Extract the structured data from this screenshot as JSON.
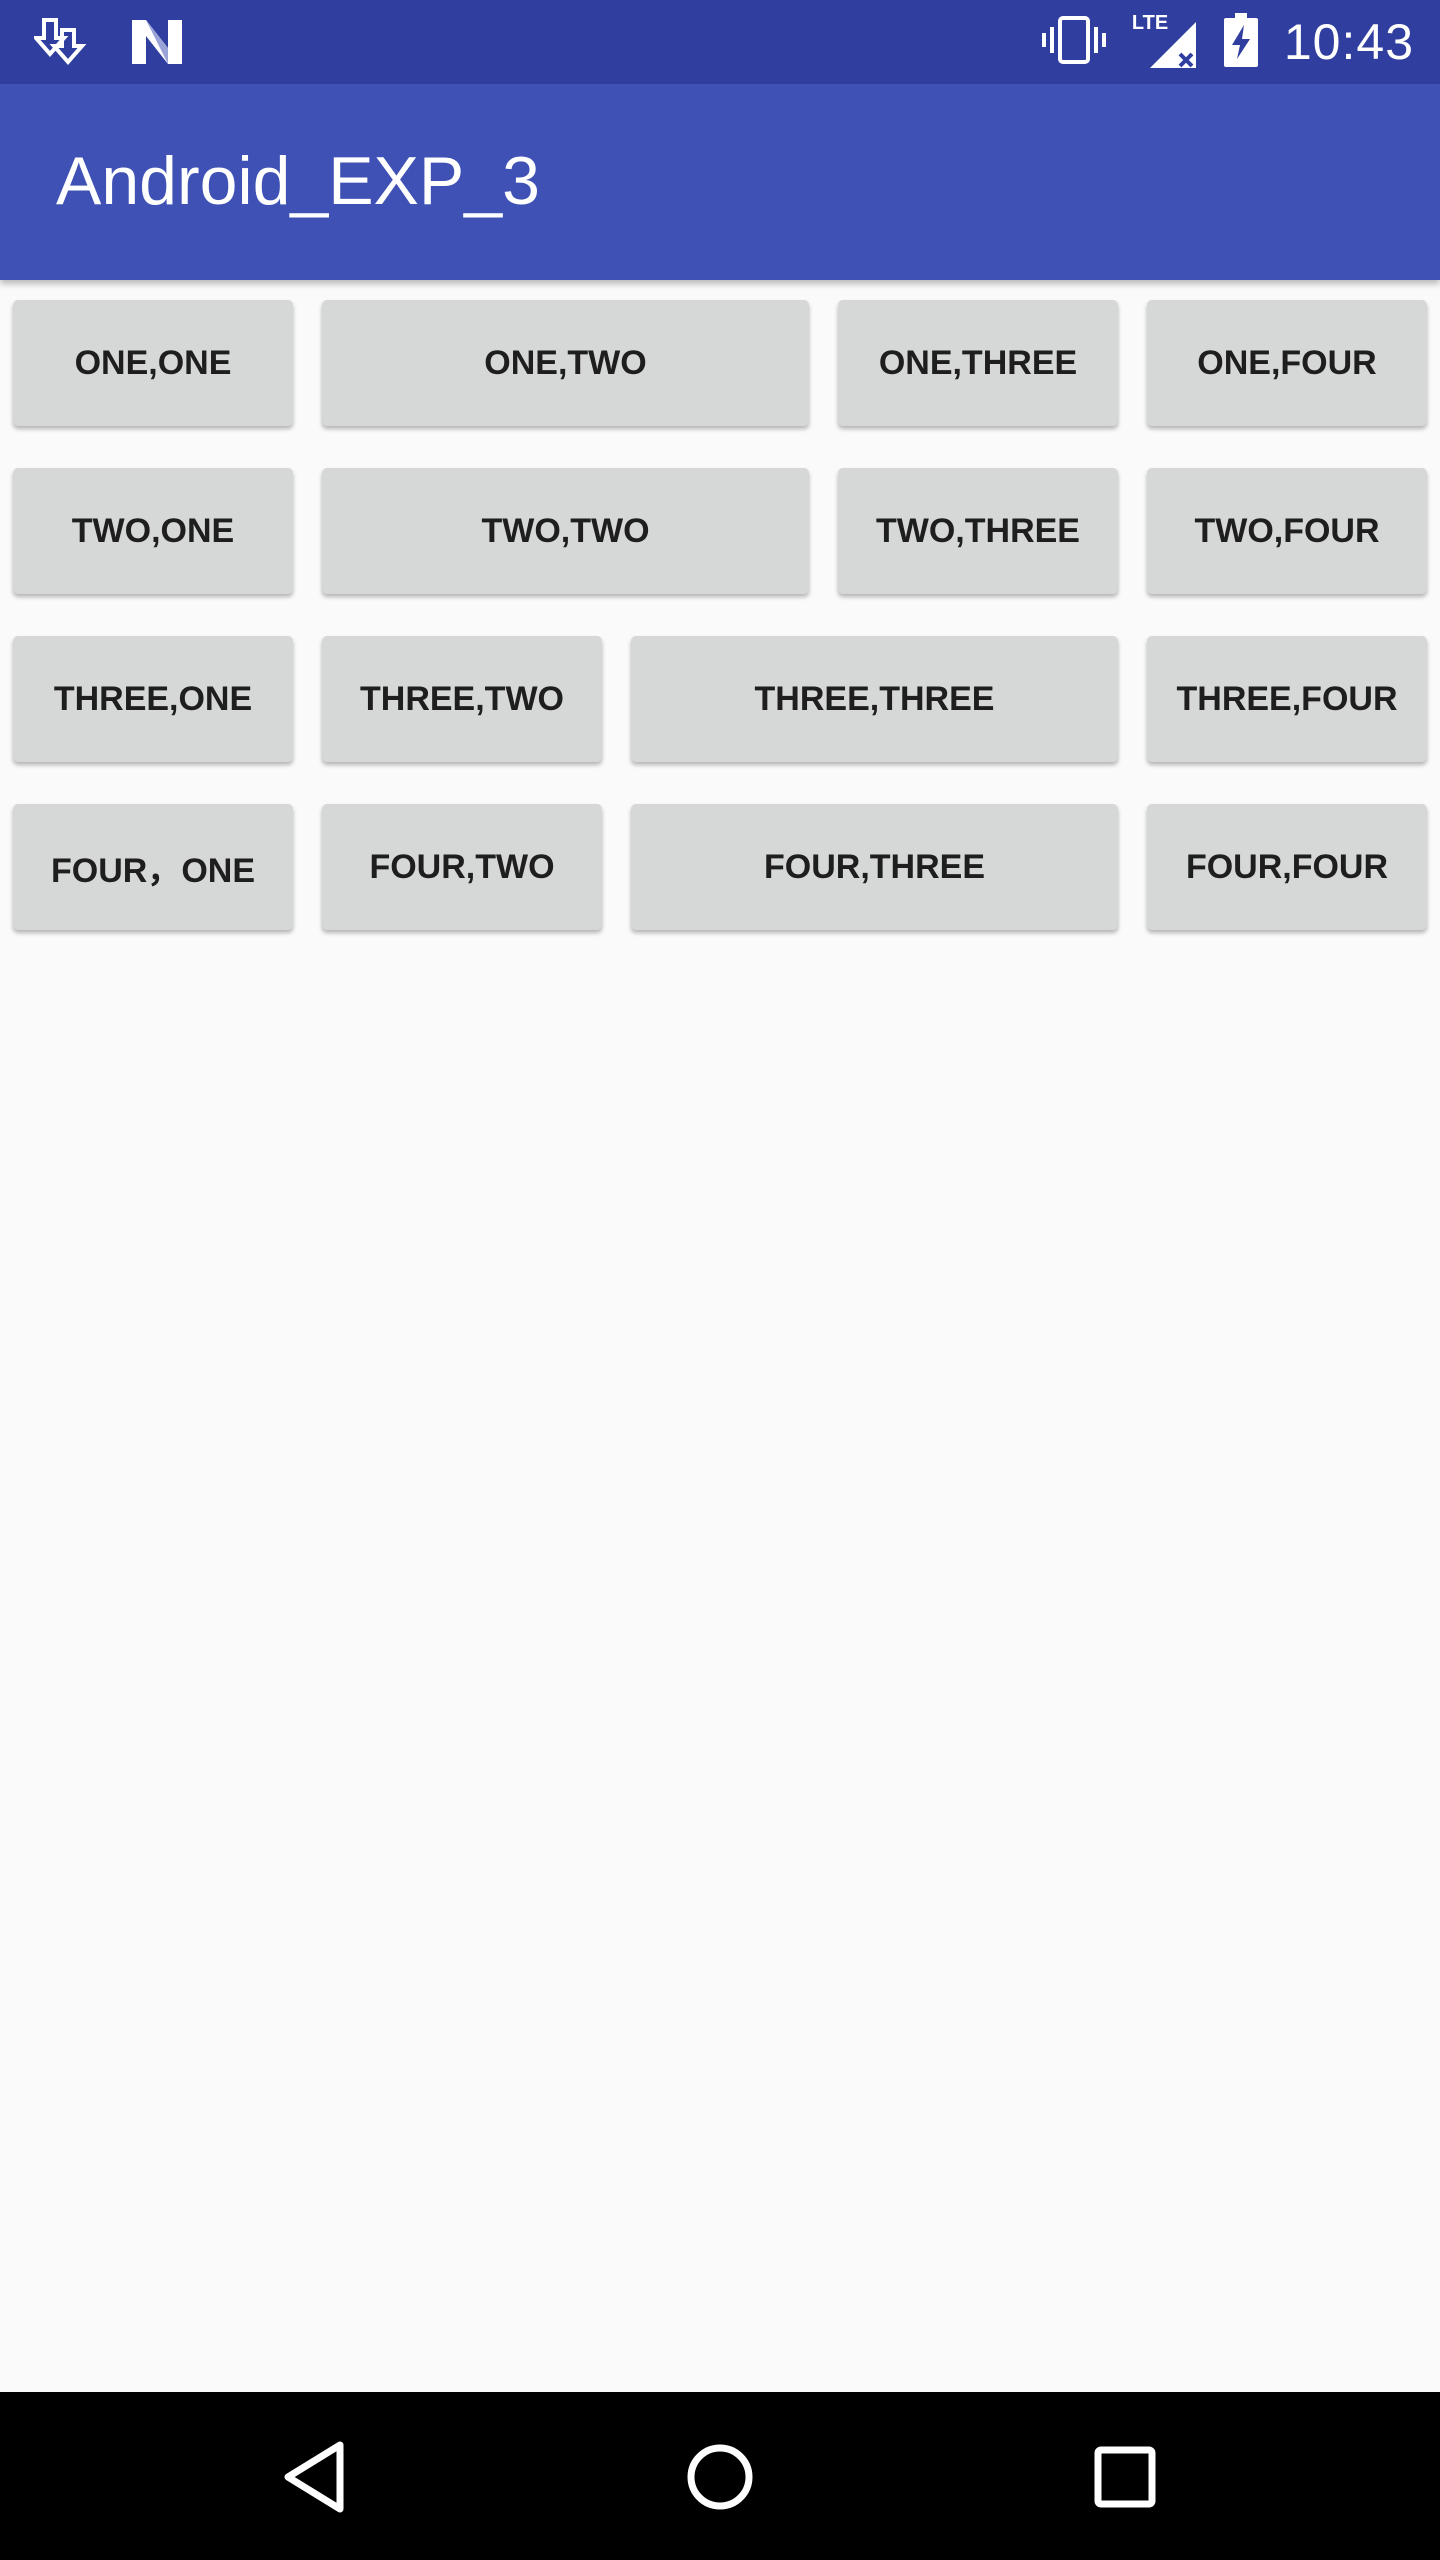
{
  "status_bar": {
    "time": "10:43",
    "left_icons": [
      "download-icon",
      "n-logo-icon"
    ],
    "right_icons": [
      "vibrate-icon",
      "lte-signal-icon",
      "battery-charging-icon"
    ],
    "network_label": "LTE",
    "color": "#303f9f"
  },
  "app_bar": {
    "title": "Android_EXP_3",
    "color": "#3f51b5"
  },
  "grid": {
    "row1": [
      "ONE,ONE",
      "ONE,TWO",
      "ONE,THREE",
      "ONE,FOUR"
    ],
    "row2": [
      "TWO,ONE",
      "TWO,TWO",
      "TWO,THREE",
      "TWO,FOUR"
    ],
    "row3": [
      "THREE,ONE",
      "THREE,TWO",
      "THREE,THREE",
      "THREE,FOUR"
    ],
    "row4": [
      "FOUR，ONE",
      "FOUR,TWO",
      "FOUR,THREE",
      "FOUR,FOUR"
    ]
  },
  "nav_bar": {
    "buttons": [
      "back-icon",
      "home-icon",
      "recents-icon"
    ]
  }
}
